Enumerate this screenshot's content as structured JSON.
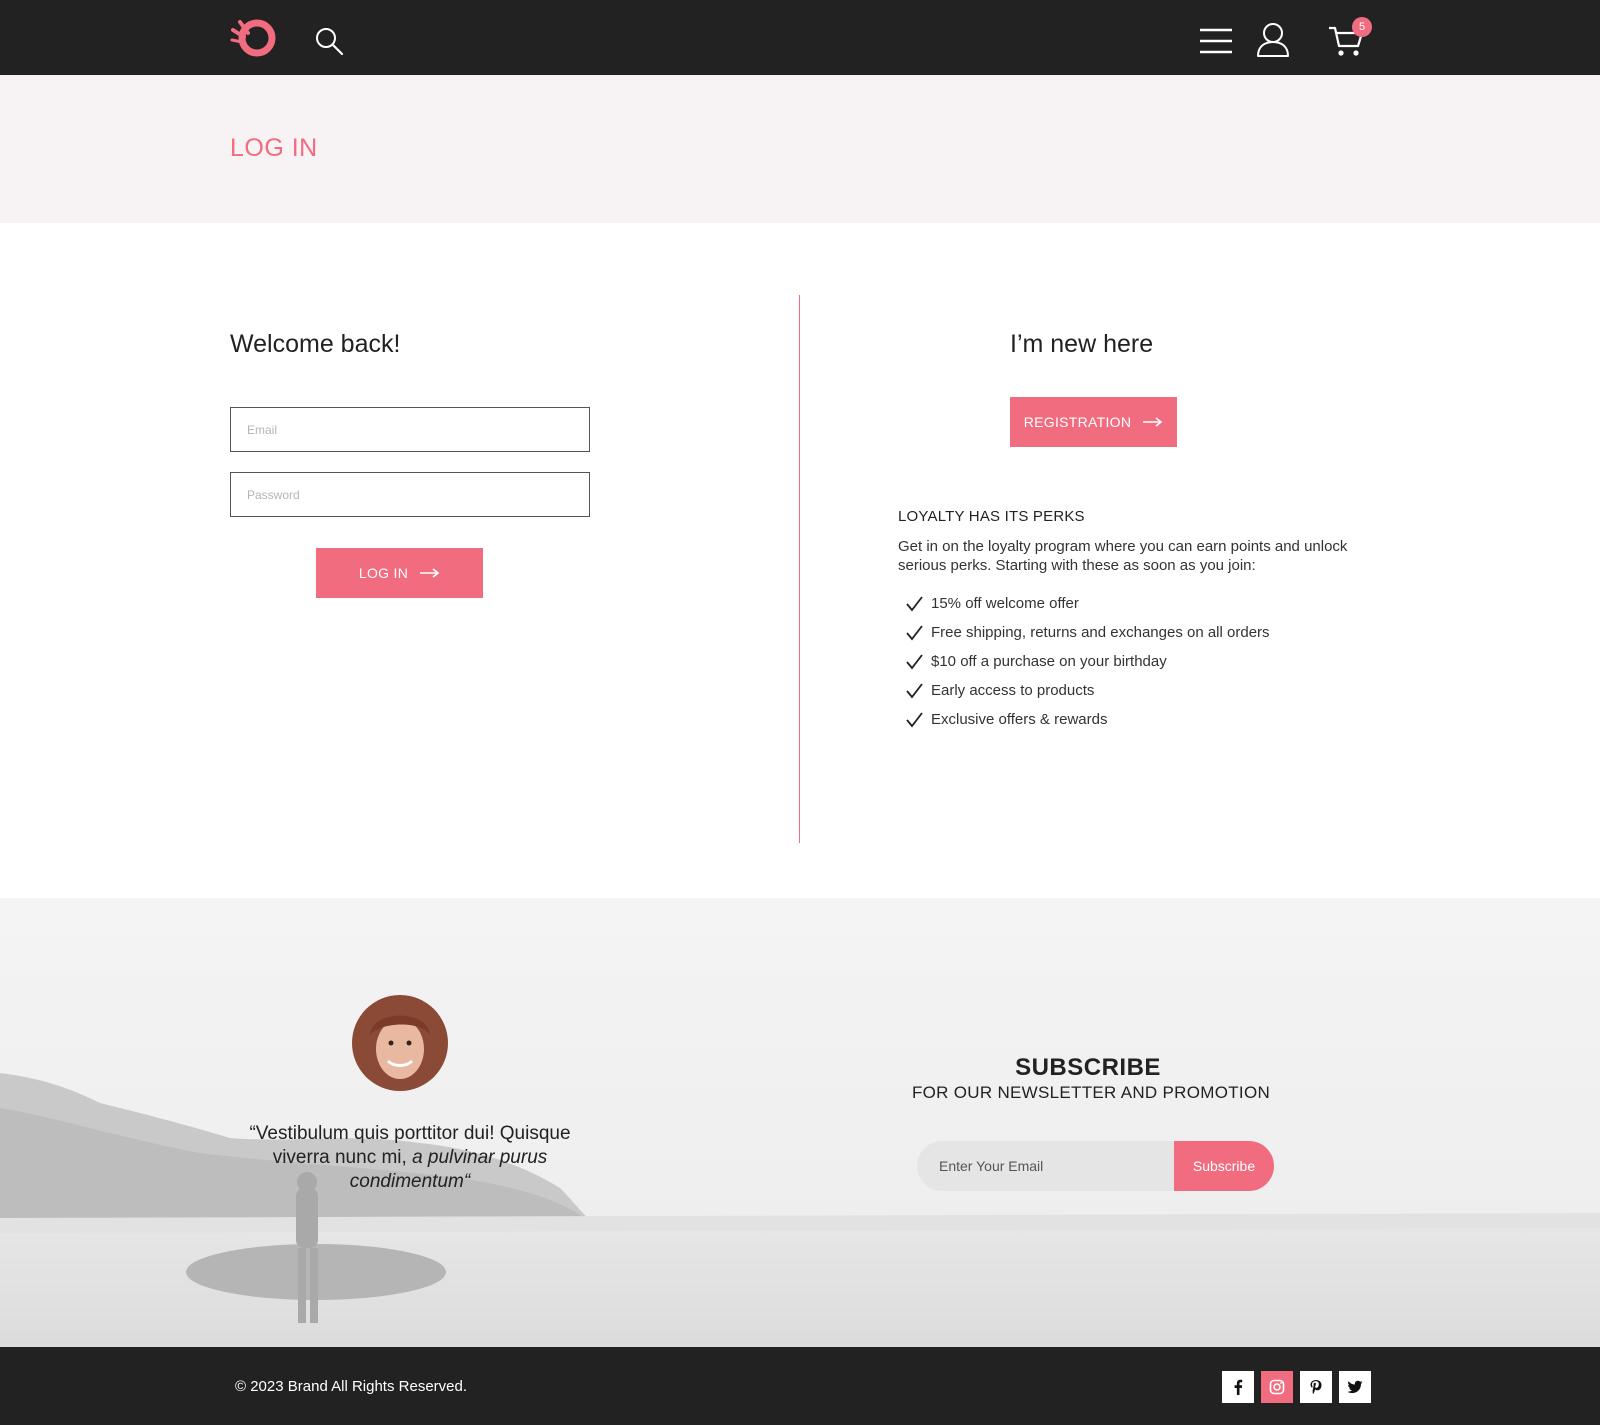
{
  "header": {
    "logo": "brand-logo",
    "icons": [
      "search-icon",
      "menu-icon",
      "user-icon",
      "cart-icon"
    ],
    "cart_count": "5"
  },
  "page": {
    "title": "LOG IN"
  },
  "login": {
    "heading": "Welcome back!",
    "email_placeholder": "Email",
    "password_placeholder": "Password",
    "button_label": "LOG IN"
  },
  "register": {
    "heading": "I’m new here",
    "button_label": "REGISTRATION",
    "perks_title": "LOYALTY HAS ITS PERKS",
    "perks_desc": "Get in on the loyalty program where you can earn points and unlock serious perks. Starting with these as soon as you join:",
    "perks": [
      "15% off welcome offer",
      "Free shipping, returns and exchanges on all orders",
      "$10 off a purchase on your birthday",
      "Early access to products",
      "Exclusive offers & rewards"
    ]
  },
  "testimonial": {
    "quote_part1": "“Vestibulum quis porttitor dui! Quisque viverra nunc mi, ",
    "quote_part2": "a pulvinar purus condimentum",
    "quote_part3": "“"
  },
  "subscribe": {
    "title": "SUBSCRIBE",
    "subtitle": "FOR OUR NEWSLETTER AND PROMOTION",
    "input_placeholder": "Enter Your Email",
    "button_label": "Subscribe"
  },
  "footer": {
    "copyright": "© 2023  Brand  All Rights Reserved.",
    "social": [
      "facebook-icon",
      "instagram-icon",
      "pinterest-icon",
      "twitter-icon"
    ]
  },
  "colors": {
    "accent": "#f26c7f",
    "dark": "#222222",
    "band": "#f7f2f3"
  }
}
